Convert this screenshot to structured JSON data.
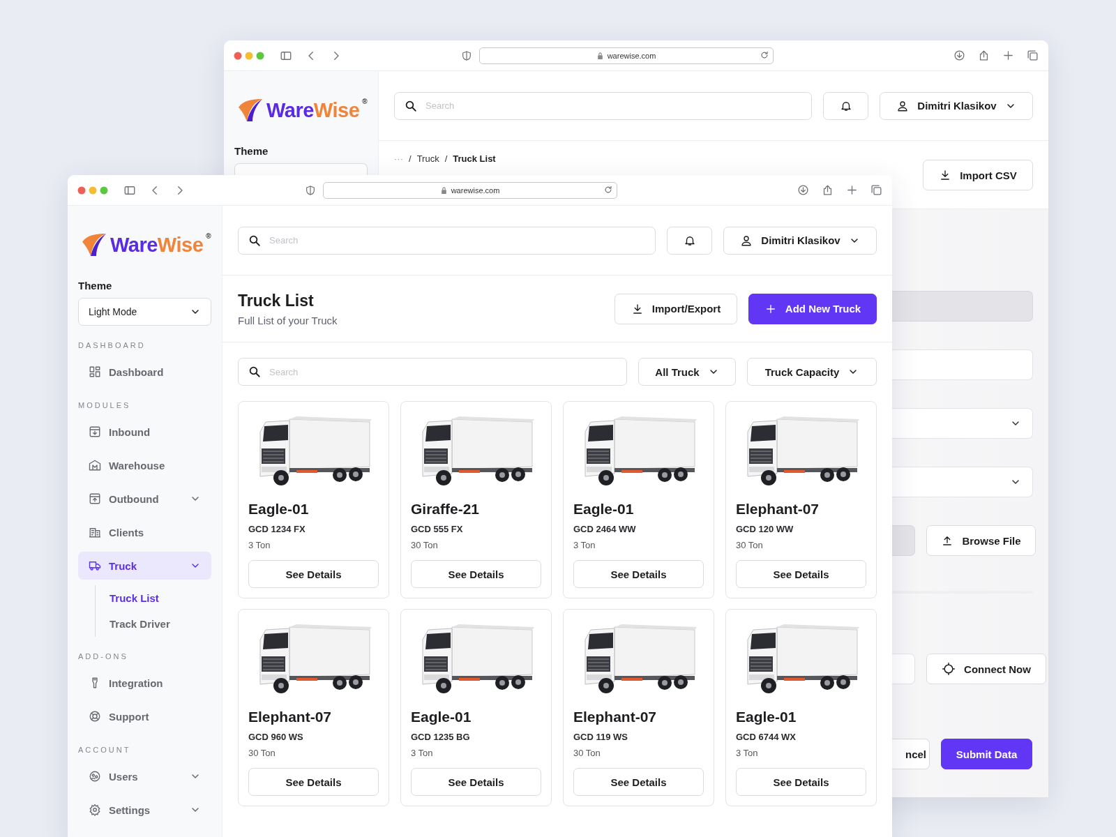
{
  "back_window": {
    "url": "warewise.com",
    "logo": {
      "brand_first": "Ware",
      "brand_second": "Wise",
      "mark": "®"
    },
    "theme_label": "Theme",
    "search": {
      "placeholder": "Search"
    },
    "user": {
      "name": "Dimitri Klasikov"
    },
    "breadcrumb": [
      {
        "text": "···",
        "kind": "ellipsis"
      },
      {
        "text": "/",
        "kind": "separator"
      },
      {
        "text": "Truck",
        "kind": "link"
      },
      {
        "text": "/",
        "kind": "separator"
      },
      {
        "text": "Truck List",
        "kind": "current"
      }
    ],
    "import_button": "Import CSV",
    "form_fields": [
      {
        "kind": "input",
        "disabled": true
      },
      {
        "kind": "input",
        "disabled": false
      },
      {
        "kind": "select",
        "disabled": false
      },
      {
        "kind": "select",
        "disabled": false
      }
    ],
    "browse_button": "Browse File",
    "connect_button": "Connect Now",
    "cancel_button": "ncel",
    "submit_button": "Submit Data"
  },
  "front_window": {
    "url": "warewise.com",
    "logo": {
      "brand_first": "Ware",
      "brand_second": "Wise",
      "mark": "®"
    },
    "theme": {
      "label": "Theme",
      "value": "Light Mode"
    },
    "nav_sections": [
      {
        "title": "DASHBOARD",
        "items": [
          {
            "label": "Dashboard",
            "expandable": false,
            "selected": false
          }
        ]
      },
      {
        "title": "MODULES",
        "items": [
          {
            "label": "Inbound",
            "expandable": false,
            "selected": false
          },
          {
            "label": "Warehouse",
            "expandable": false,
            "selected": false
          },
          {
            "label": "Outbound",
            "expandable": true,
            "selected": false
          },
          {
            "label": "Clients",
            "expandable": false,
            "selected": false
          },
          {
            "label": "Truck",
            "expandable": true,
            "selected": true,
            "children": [
              {
                "label": "Truck List",
                "selected": true
              },
              {
                "label": "Track Driver",
                "selected": false
              }
            ]
          }
        ]
      },
      {
        "title": "ADD-ONS",
        "items": [
          {
            "label": "Integration",
            "expandable": false,
            "selected": false
          },
          {
            "label": "Support",
            "expandable": false,
            "selected": false
          }
        ]
      },
      {
        "title": "ACCOUNT",
        "items": [
          {
            "label": "Users",
            "expandable": true,
            "selected": false
          },
          {
            "label": "Settings",
            "expandable": true,
            "selected": false
          }
        ]
      }
    ],
    "search": {
      "placeholder": "Search"
    },
    "user": {
      "name": "Dimitri Klasikov"
    },
    "page": {
      "title": "Truck List",
      "subtitle": "Full List of your Truck"
    },
    "import_export_button": "Import/Export",
    "add_button": "Add New Truck",
    "filter_search": {
      "placeholder": "Search"
    },
    "filters": [
      "All Truck",
      "Truck Capacity"
    ],
    "trucks": [
      {
        "name": "Eagle-01",
        "plate": "GCD 1234 FX",
        "capacity": "3 Ton",
        "button": "See Details"
      },
      {
        "name": "Giraffe-21",
        "plate": "GCD 555 FX",
        "capacity": "30 Ton",
        "button": "See Details"
      },
      {
        "name": "Eagle-01",
        "plate": "GCD 2464 WW",
        "capacity": "3 Ton",
        "button": "See Details"
      },
      {
        "name": "Elephant-07",
        "plate": "GCD 120 WW",
        "capacity": "30 Ton",
        "button": "See Details"
      },
      {
        "name": "Elephant-07",
        "plate": "GCD 960 WS",
        "capacity": "30 Ton",
        "button": "See Details"
      },
      {
        "name": "Eagle-01",
        "plate": "GCD 1235 BG",
        "capacity": "3 Ton",
        "button": "See Details"
      },
      {
        "name": "Elephant-07",
        "plate": "GCD 119 WS",
        "capacity": "30 Ton",
        "button": "See Details"
      },
      {
        "name": "Eagle-01",
        "plate": "GCD 6744 WX",
        "capacity": "3 Ton",
        "button": "See Details"
      }
    ]
  }
}
